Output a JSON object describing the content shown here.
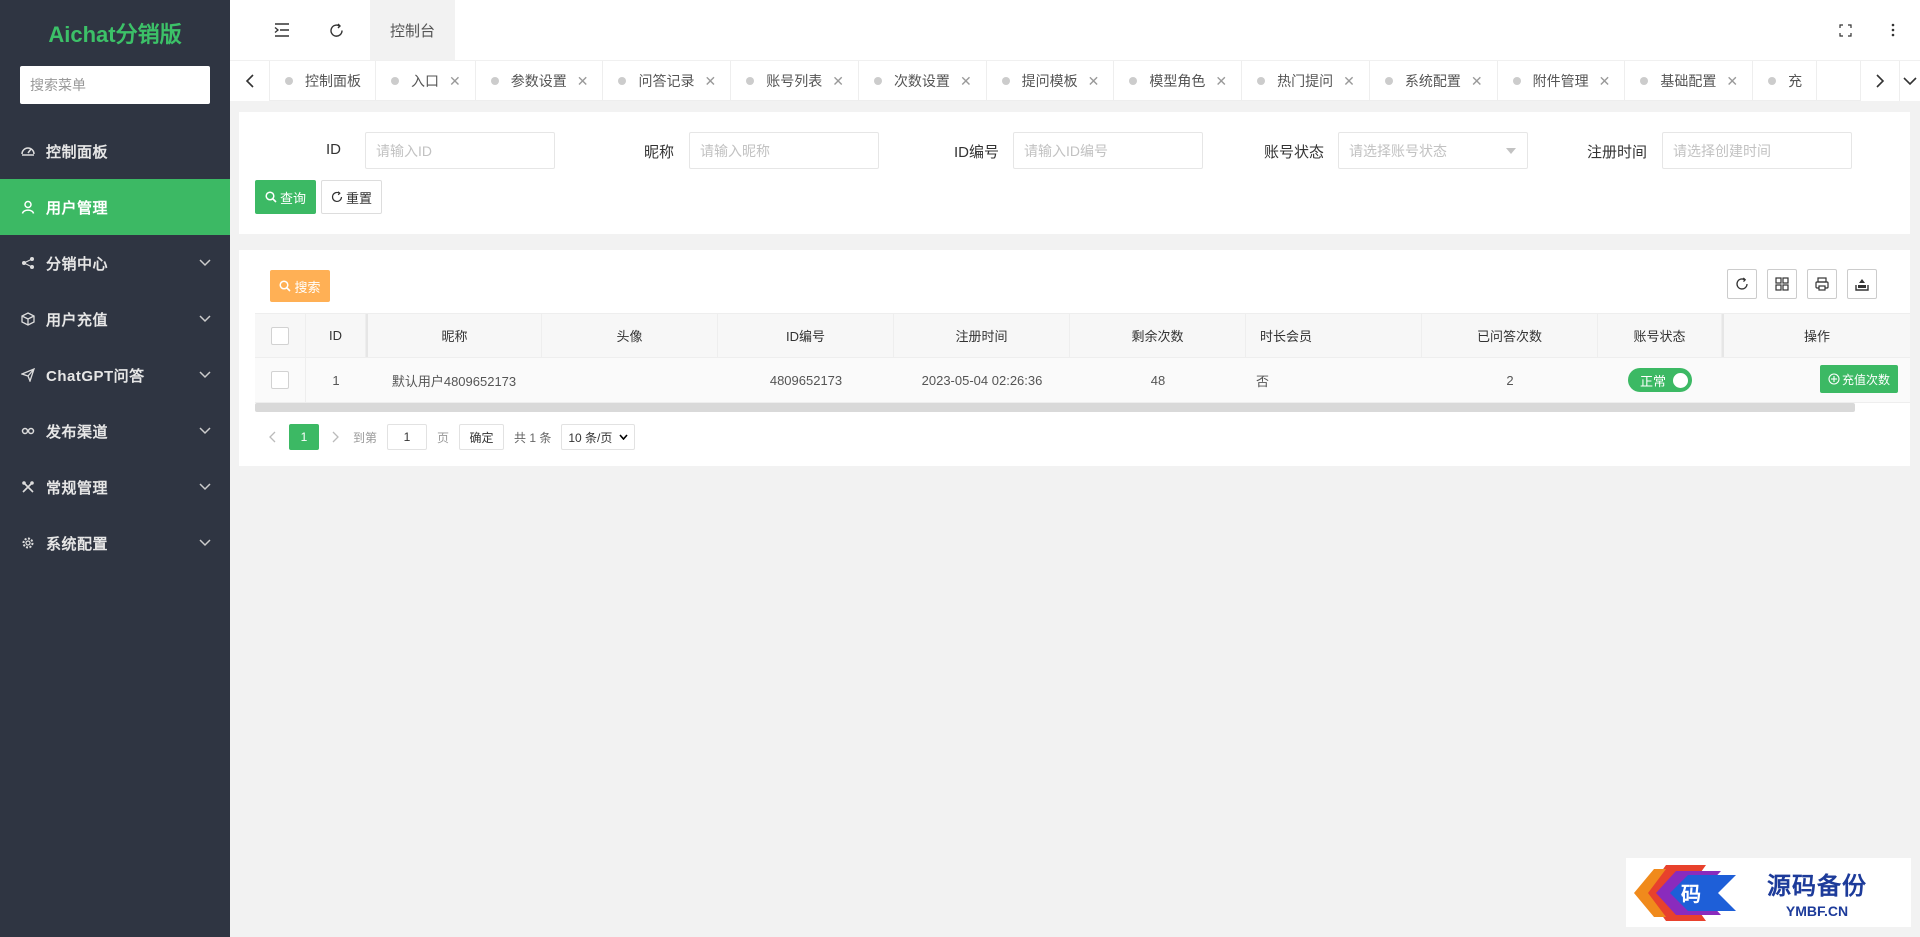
{
  "sidebar": {
    "brand": "Aichat分销版",
    "search_placeholder": "搜索菜单",
    "items": [
      {
        "label": "控制面板",
        "icon": "dashboard-icon"
      },
      {
        "label": "用户管理",
        "icon": "user-icon",
        "active": true
      },
      {
        "label": "分销中心",
        "icon": "share-icon"
      },
      {
        "label": "用户充值",
        "icon": "box-icon"
      },
      {
        "label": "ChatGPT问答",
        "icon": "send-icon"
      },
      {
        "label": "发布渠道",
        "icon": "infinity-icon"
      },
      {
        "label": "常规管理",
        "icon": "tools-icon"
      },
      {
        "label": "系统配置",
        "icon": "gear-icon"
      }
    ]
  },
  "header": {
    "active_tab": "控制台",
    "icons": [
      "menu-fold-icon",
      "refresh-icon",
      "fullscreen-icon",
      "more-vertical-icon"
    ]
  },
  "tabs": [
    "控制面板",
    "入口",
    "参数设置",
    "问答记录",
    "账号列表",
    "次数设置",
    "提问模板",
    "模型角色",
    "热门提问",
    "系统配置",
    "附件管理",
    "基础配置",
    "充"
  ],
  "filter": {
    "fields": [
      {
        "label": "ID",
        "placeholder": "请输入ID"
      },
      {
        "label": "昵称",
        "placeholder": "请输入昵称"
      },
      {
        "label": "ID编号",
        "placeholder": "请输入ID编号"
      },
      {
        "label": "账号状态",
        "placeholder": "请选择账号状态"
      },
      {
        "label": "注册时间",
        "placeholder": "请选择创建时间"
      }
    ],
    "query_label": "查询",
    "reset_label": "重置"
  },
  "table": {
    "search_label": "搜索",
    "columns": [
      "ID",
      "昵称",
      "头像",
      "ID编号",
      "注册时间",
      "剩余次数",
      "时长会员",
      "已问答次数",
      "账号状态",
      "操作"
    ],
    "rows": [
      {
        "id": "1",
        "nickname": "默认用户4809652173",
        "avatar": "",
        "id_no": "4809652173",
        "reg_time": "2023-05-04 02:26:36",
        "remaining": "48",
        "member": "否",
        "answered": "2",
        "status": "正常",
        "action": "充值次数"
      }
    ]
  },
  "pager": {
    "current": "1",
    "goto_prefix": "到第",
    "goto_value": "1",
    "goto_suffix": "页",
    "confirm": "确定",
    "total": "共 1 条",
    "page_size": "10 条/页"
  },
  "watermark": {
    "cn": "源码备份",
    "en": "YMBF.CN",
    "logo_char": "码"
  }
}
